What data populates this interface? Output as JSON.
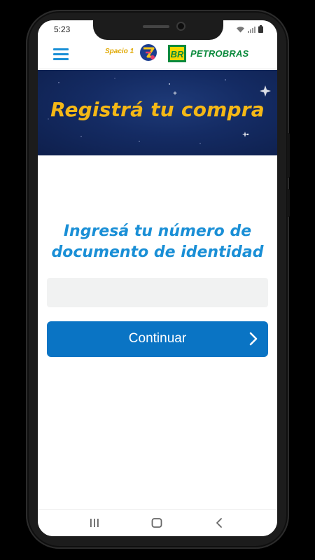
{
  "status_bar": {
    "time": "5:23"
  },
  "header": {
    "menu_icon": "hamburger-icon",
    "spacio_label": "Spacio 1",
    "br_label": "BR",
    "petrobras_label": "PETROBRAS"
  },
  "banner": {
    "title": "Registrá tu compra"
  },
  "form": {
    "heading_line1": "Ingresá tu número de",
    "heading_line2": "documento de identidad",
    "document_input_value": "",
    "document_input_placeholder": "",
    "continue_label": "Continuar",
    "continue_icon": "chevron-right-icon"
  },
  "nav_bar": {
    "recents_icon": "recents-icon",
    "home_icon": "home-icon",
    "back_icon": "back-icon"
  },
  "colors": {
    "accent_blue": "#1a8fd6",
    "button_blue": "#0a74c4",
    "banner_title": "#f5b816",
    "banner_bg": "#142b63",
    "petrobras_green": "#0a8a3c",
    "spacio_yellow": "#e0a800"
  }
}
